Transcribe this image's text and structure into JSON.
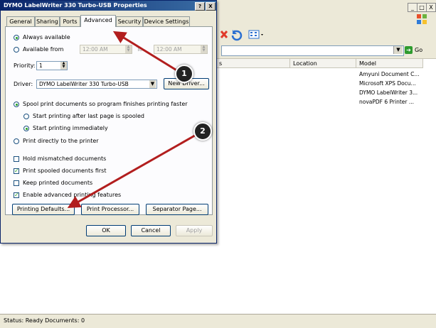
{
  "background_window": {
    "controls": [
      "_",
      "□",
      "X"
    ],
    "address_go": "Go",
    "columns": [
      "s",
      "Location",
      "Model"
    ],
    "models": [
      "Amyuni Document C...",
      "Microsoft XPS Docu...",
      "DYMO LabelWriter 3...",
      "novaPDF 6 Printer ..."
    ],
    "status": "Status: Ready Documents: 0"
  },
  "dialog": {
    "title": "DYMO LabelWriter 330 Turbo-USB Properties",
    "title_buttons": [
      "?",
      "X"
    ],
    "tabs": [
      "General",
      "Sharing",
      "Ports",
      "Advanced",
      "Security",
      "Device Settings"
    ],
    "active_tab": "Advanced",
    "always_available": "Always available",
    "available_from": "Available from",
    "time_from": "12:00 AM",
    "time_to_label": "To",
    "time_to": "12:00 AM",
    "priority_label": "Priority:",
    "priority_value": "1",
    "driver_label": "Driver:",
    "driver_value": "DYMO LabelWriter 330 Turbo-USB",
    "new_driver": "New Driver...",
    "spool": "Spool print documents so program finishes printing faster",
    "start_after": "Start printing after last page is spooled",
    "start_immediately": "Start printing immediately",
    "print_direct": "Print directly to the printer",
    "hold_mismatched": "Hold mismatched documents",
    "print_spooled_first": "Print spooled documents first",
    "keep_printed": "Keep printed documents",
    "enable_advanced": "Enable advanced printing features",
    "printing_defaults": "Printing Defaults...",
    "print_processor": "Print Processor...",
    "separator_page": "Separator Page...",
    "ok": "OK",
    "cancel": "Cancel",
    "apply": "Apply"
  },
  "annotations": {
    "badge1": "1",
    "badge2": "2",
    "color": "#b21e1e"
  }
}
